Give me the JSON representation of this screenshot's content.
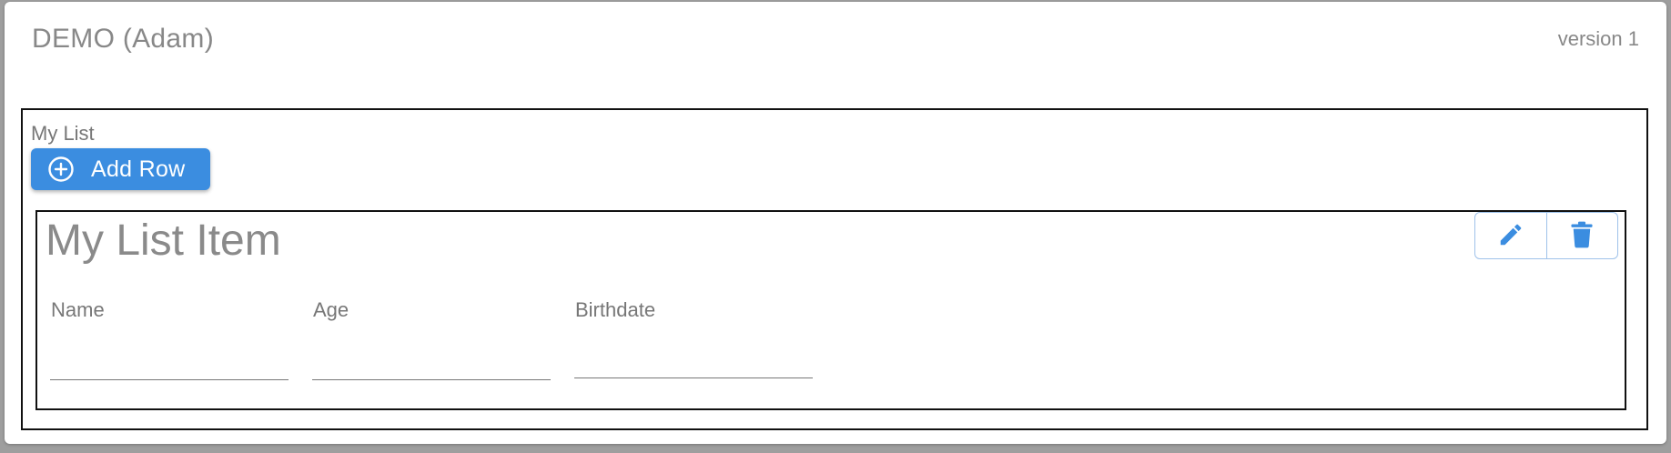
{
  "header": {
    "title": "DEMO (Adam)",
    "version": "version 1"
  },
  "list": {
    "label": "My List",
    "add_button_label": "Add Row",
    "add_button_icon": "plus-circle-icon",
    "items": [
      {
        "title": "My List Item",
        "actions": [
          {
            "name": "edit",
            "icon": "pencil-icon"
          },
          {
            "name": "delete",
            "icon": "trash-icon"
          }
        ],
        "fields": [
          {
            "label": "Name",
            "value": "",
            "placeholder": ""
          },
          {
            "label": "Age",
            "value": "",
            "placeholder": ""
          },
          {
            "label": "Birthdate",
            "value": "",
            "placeholder": ""
          }
        ]
      }
    ]
  },
  "colors": {
    "primary": "#3b8de0",
    "text_muted": "#888888",
    "action_border": "#9fc2ea",
    "border_dark": "#111111"
  }
}
